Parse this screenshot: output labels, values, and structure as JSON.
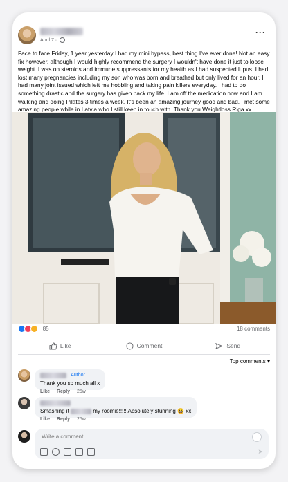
{
  "post": {
    "date": "April 7",
    "text": "Face to face Friday, 1 year yesterday I had my mini bypass, best thing I've ever done! Not an easy fix however, although I would highly recommend the surgery I wouldn't have done it just to loose weight. I was on steroids and immune suppressants for my health as I had suspected lupus. I had lost many pregnancies including my son who was born and breathed but only lived for an hour. I had many joint issued which left me hobbling and taking pain killers everyday. I had to do something drastic and the surgery has given back my life. I am off the medication now and I am walking and doing Pilates 3 times a week. It's been an amazing journey good and bad. I met some amazing people while in Latvia who I still keep in touch with. Thank you Weightloss Riga xx"
  },
  "reactions": {
    "count": "85",
    "comments": "18 comments"
  },
  "actions": {
    "like": "Like",
    "comment": "Comment",
    "send": "Send"
  },
  "top_comments_label": "Top comments",
  "comments": [
    {
      "tag": "Author",
      "text": "Thank you so much all x",
      "like": "Like",
      "reply": "Reply",
      "time": "25w"
    },
    {
      "text_a": "Smashing it",
      "text_b": "my roomie!!!!! Absolutely stunning 😀 xx",
      "like": "Like",
      "reply": "Reply",
      "time": "25w"
    }
  ],
  "compose": {
    "placeholder": "Write a comment..."
  },
  "colors": {
    "accent": "#1877f2",
    "text": "#050505",
    "muted": "#65676b"
  }
}
